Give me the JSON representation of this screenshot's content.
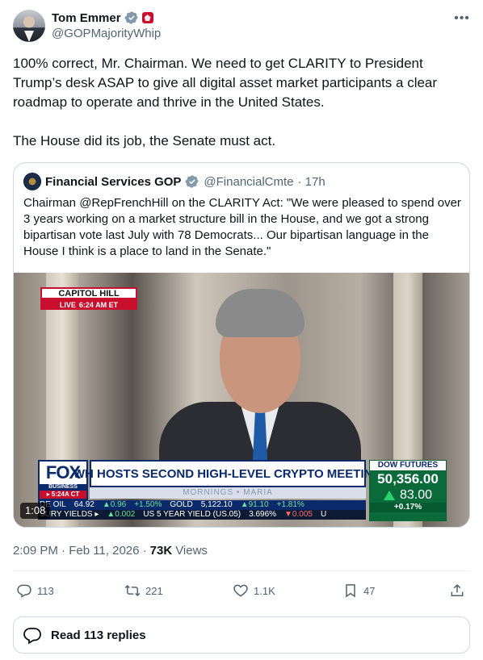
{
  "author": {
    "display_name": "Tom Emmer",
    "handle": "@GOPMajorityWhip"
  },
  "tweet": {
    "text": "100% correct, Mr. Chairman. We need to get CLARITY to President Trump’s desk ASAP to give all digital asset market participants a clear roadmap to operate and thrive in the United States.\n\nThe House did its job, the Senate must act."
  },
  "quote": {
    "display_name": "Financial Services GOP",
    "handle": "@FinancialCmte",
    "time": "· 17h",
    "text": "Chairman @RepFrenchHill on the CLARITY Act: \"We were pleased to spend over 3 years working on a market structure bill in the House, and we got a strong bipartisan vote last July with 78 Democrats... Our bipartisan language in the House I think is a place to land in the Senate.\""
  },
  "video": {
    "duration": "1:08",
    "bug_top": "CAPITOL HILL",
    "bug_live": "LIVE",
    "bug_time": "6:24 AM ET",
    "network": "FOX",
    "network_sub": "BUSINESS",
    "network_time": "▸ 5:24A CT",
    "headline": "WH HOSTS SECOND HIGH-LEVEL CRYPTO MEETING",
    "show": "MORNINGS • MARIA",
    "dow_label": "DOW FUTURES",
    "dow_value": "50,356.00",
    "dow_change": "83.00",
    "dow_pct": "+0.17%",
    "ticker1": [
      "DE OIL",
      "64.92",
      "▲0.96",
      "+1.50%",
      "GOLD",
      "5,122.10",
      "▲91.10",
      "+1.81%"
    ],
    "ticker2": [
      "SURY YIELDS ▸",
      "▲0.002",
      "US 5 YEAR YIELD (US.05)",
      "3.696%",
      "▼0.005",
      "U"
    ]
  },
  "meta": {
    "timestamp": "2:09 PM · Feb 11, 2026 ·",
    "views_count": "73K",
    "views_label": "Views"
  },
  "actions": {
    "replies": "113",
    "reposts": "221",
    "likes": "1.1K",
    "bookmarks": "47"
  },
  "read_replies": "Read 113 replies",
  "colors": {
    "text": "#0f1419",
    "muted": "#536471",
    "border": "#cfd9de",
    "verified": "#829aab"
  }
}
